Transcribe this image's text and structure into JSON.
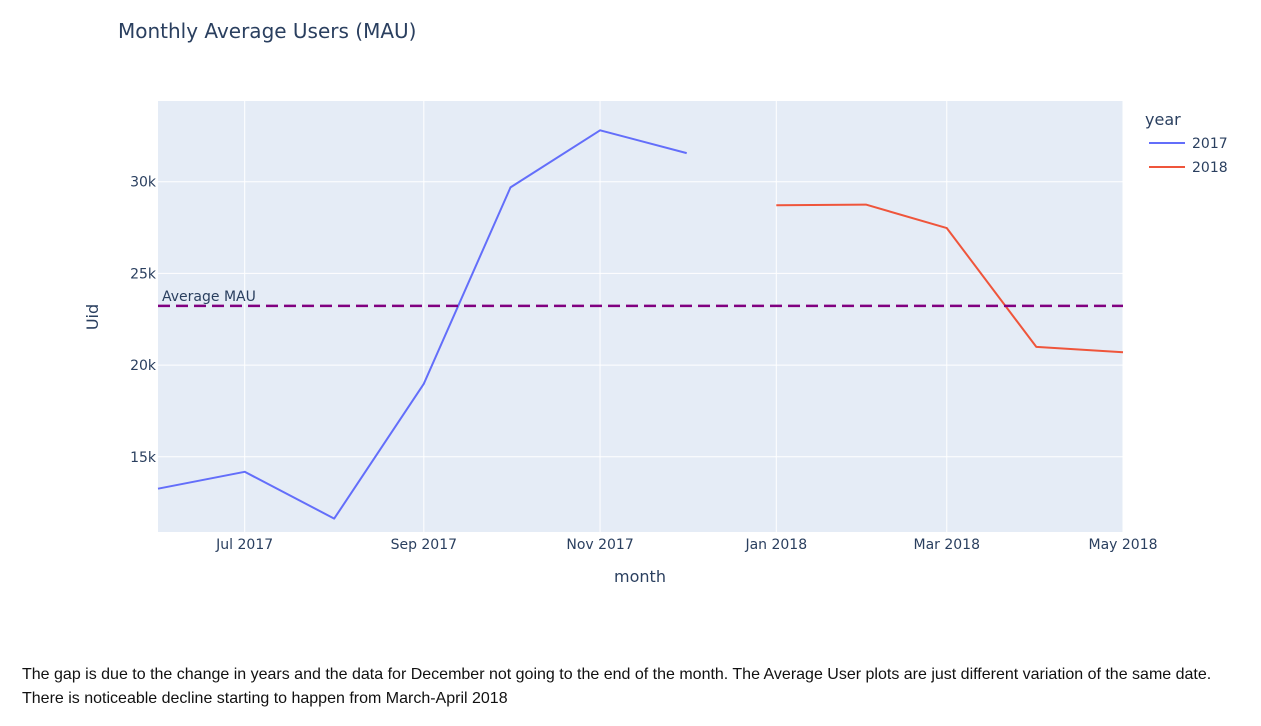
{
  "chart_data": {
    "type": "line",
    "title": "Monthly Average Users (MAU)",
    "xlabel": "month",
    "ylabel": "Uid",
    "legend_title": "year",
    "legend_position": "top-right",
    "grid": true,
    "x_ticks": [
      {
        "date": "2017-07-01",
        "label": "Jul 2017"
      },
      {
        "date": "2017-09-01",
        "label": "Sep 2017"
      },
      {
        "date": "2017-11-01",
        "label": "Nov 2017"
      },
      {
        "date": "2018-01-01",
        "label": "Jan 2018"
      },
      {
        "date": "2018-03-01",
        "label": "Mar 2018"
      },
      {
        "date": "2018-05-01",
        "label": "May 2018"
      }
    ],
    "xlim": [
      "2017-06-01",
      "2018-05-01"
    ],
    "y_ticks": [
      {
        "value": 15000,
        "label": "15k"
      },
      {
        "value": 20000,
        "label": "20k"
      },
      {
        "value": 25000,
        "label": "25k"
      },
      {
        "value": 30000,
        "label": "30k"
      }
    ],
    "ylim": [
      10900,
      34400
    ],
    "series": [
      {
        "name": "2017",
        "color": "#636efa",
        "points": [
          {
            "x": "2017-06-01",
            "y": 13260
          },
          {
            "x": "2017-07-01",
            "y": 14180
          },
          {
            "x": "2017-08-01",
            "y": 11630
          },
          {
            "x": "2017-09-01",
            "y": 18980
          },
          {
            "x": "2017-10-01",
            "y": 29690
          },
          {
            "x": "2017-11-01",
            "y": 32800
          },
          {
            "x": "2017-12-01",
            "y": 31560
          }
        ]
      },
      {
        "name": "2018",
        "color": "#ef553b",
        "points": [
          {
            "x": "2018-01-01",
            "y": 28720
          },
          {
            "x": "2018-02-01",
            "y": 28750
          },
          {
            "x": "2018-03-01",
            "y": 27470
          },
          {
            "x": "2018-04-01",
            "y": 20990
          },
          {
            "x": "2018-05-01",
            "y": 20700
          }
        ]
      }
    ],
    "reference_line": {
      "label": "Average MAU",
      "y": 23230,
      "color": "#800080",
      "style": "dashed"
    }
  },
  "caption": "The gap is due to the change in years and the data for December not going to the end of the month. The Average User plots are just different variation of the same date. There is noticeable decline starting to happen from March-April 2018",
  "colors": {
    "plot_background": "#e5ecf6",
    "grid": "#ffffff",
    "text": "#2a3f5f"
  }
}
